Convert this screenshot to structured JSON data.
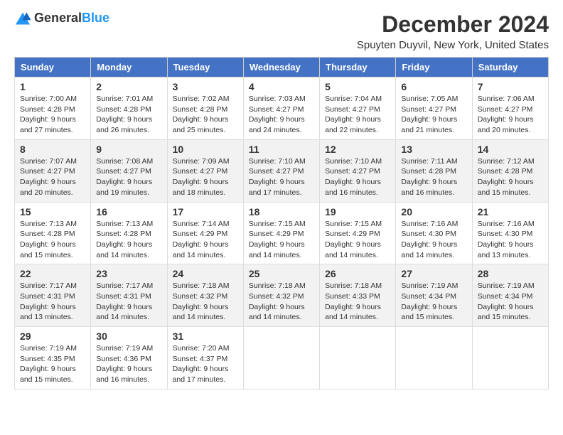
{
  "logo": {
    "general": "General",
    "blue": "Blue"
  },
  "title": "December 2024",
  "subtitle": "Spuyten Duyvil, New York, United States",
  "headers": [
    "Sunday",
    "Monday",
    "Tuesday",
    "Wednesday",
    "Thursday",
    "Friday",
    "Saturday"
  ],
  "weeks": [
    [
      {
        "day": "1",
        "sunrise": "7:00 AM",
        "sunset": "4:28 PM",
        "daylight": "9 hours and 27 minutes."
      },
      {
        "day": "2",
        "sunrise": "7:01 AM",
        "sunset": "4:28 PM",
        "daylight": "9 hours and 26 minutes."
      },
      {
        "day": "3",
        "sunrise": "7:02 AM",
        "sunset": "4:28 PM",
        "daylight": "9 hours and 25 minutes."
      },
      {
        "day": "4",
        "sunrise": "7:03 AM",
        "sunset": "4:27 PM",
        "daylight": "9 hours and 24 minutes."
      },
      {
        "day": "5",
        "sunrise": "7:04 AM",
        "sunset": "4:27 PM",
        "daylight": "9 hours and 22 minutes."
      },
      {
        "day": "6",
        "sunrise": "7:05 AM",
        "sunset": "4:27 PM",
        "daylight": "9 hours and 21 minutes."
      },
      {
        "day": "7",
        "sunrise": "7:06 AM",
        "sunset": "4:27 PM",
        "daylight": "9 hours and 20 minutes."
      }
    ],
    [
      {
        "day": "8",
        "sunrise": "7:07 AM",
        "sunset": "4:27 PM",
        "daylight": "9 hours and 20 minutes."
      },
      {
        "day": "9",
        "sunrise": "7:08 AM",
        "sunset": "4:27 PM",
        "daylight": "9 hours and 19 minutes."
      },
      {
        "day": "10",
        "sunrise": "7:09 AM",
        "sunset": "4:27 PM",
        "daylight": "9 hours and 18 minutes."
      },
      {
        "day": "11",
        "sunrise": "7:10 AM",
        "sunset": "4:27 PM",
        "daylight": "9 hours and 17 minutes."
      },
      {
        "day": "12",
        "sunrise": "7:10 AM",
        "sunset": "4:27 PM",
        "daylight": "9 hours and 16 minutes."
      },
      {
        "day": "13",
        "sunrise": "7:11 AM",
        "sunset": "4:28 PM",
        "daylight": "9 hours and 16 minutes."
      },
      {
        "day": "14",
        "sunrise": "7:12 AM",
        "sunset": "4:28 PM",
        "daylight": "9 hours and 15 minutes."
      }
    ],
    [
      {
        "day": "15",
        "sunrise": "7:13 AM",
        "sunset": "4:28 PM",
        "daylight": "9 hours and 15 minutes."
      },
      {
        "day": "16",
        "sunrise": "7:13 AM",
        "sunset": "4:28 PM",
        "daylight": "9 hours and 14 minutes."
      },
      {
        "day": "17",
        "sunrise": "7:14 AM",
        "sunset": "4:29 PM",
        "daylight": "9 hours and 14 minutes."
      },
      {
        "day": "18",
        "sunrise": "7:15 AM",
        "sunset": "4:29 PM",
        "daylight": "9 hours and 14 minutes."
      },
      {
        "day": "19",
        "sunrise": "7:15 AM",
        "sunset": "4:29 PM",
        "daylight": "9 hours and 14 minutes."
      },
      {
        "day": "20",
        "sunrise": "7:16 AM",
        "sunset": "4:30 PM",
        "daylight": "9 hours and 14 minutes."
      },
      {
        "day": "21",
        "sunrise": "7:16 AM",
        "sunset": "4:30 PM",
        "daylight": "9 hours and 13 minutes."
      }
    ],
    [
      {
        "day": "22",
        "sunrise": "7:17 AM",
        "sunset": "4:31 PM",
        "daylight": "9 hours and 13 minutes."
      },
      {
        "day": "23",
        "sunrise": "7:17 AM",
        "sunset": "4:31 PM",
        "daylight": "9 hours and 14 minutes."
      },
      {
        "day": "24",
        "sunrise": "7:18 AM",
        "sunset": "4:32 PM",
        "daylight": "9 hours and 14 minutes."
      },
      {
        "day": "25",
        "sunrise": "7:18 AM",
        "sunset": "4:32 PM",
        "daylight": "9 hours and 14 minutes."
      },
      {
        "day": "26",
        "sunrise": "7:18 AM",
        "sunset": "4:33 PM",
        "daylight": "9 hours and 14 minutes."
      },
      {
        "day": "27",
        "sunrise": "7:19 AM",
        "sunset": "4:34 PM",
        "daylight": "9 hours and 15 minutes."
      },
      {
        "day": "28",
        "sunrise": "7:19 AM",
        "sunset": "4:34 PM",
        "daylight": "9 hours and 15 minutes."
      }
    ],
    [
      {
        "day": "29",
        "sunrise": "7:19 AM",
        "sunset": "4:35 PM",
        "daylight": "9 hours and 15 minutes."
      },
      {
        "day": "30",
        "sunrise": "7:19 AM",
        "sunset": "4:36 PM",
        "daylight": "9 hours and 16 minutes."
      },
      {
        "day": "31",
        "sunrise": "7:20 AM",
        "sunset": "4:37 PM",
        "daylight": "9 hours and 17 minutes."
      },
      null,
      null,
      null,
      null
    ]
  ],
  "labels": {
    "sunrise": "Sunrise:",
    "sunset": "Sunset:",
    "daylight": "Daylight:"
  }
}
